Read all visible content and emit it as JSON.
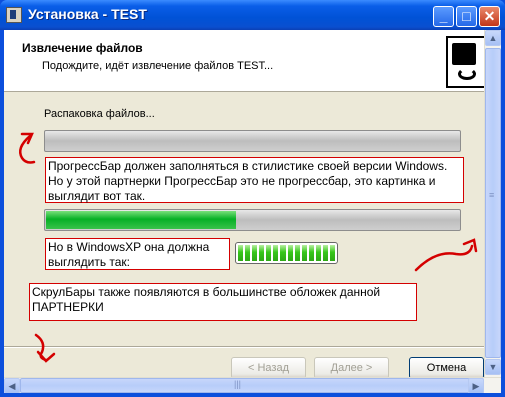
{
  "window": {
    "title": "Установка - TEST",
    "minimize_glyph": "_",
    "maximize_glyph": "□",
    "close_glyph": "✕"
  },
  "header": {
    "title": "Извлечение файлов",
    "subtitle": "Подождите, идёт извлечение файлов TEST..."
  },
  "main": {
    "status": "Распаковка файлов...",
    "progress_top": 0,
    "progress_main": 0.46,
    "progress_xp_segments": 14,
    "notes": {
      "note1": "ПрогрессБар должен заполняться в стилистике своей версии Windows. Но у этой партнерки ПрогрессБар это не прогрессбар, это картинка и выглядит вот так.",
      "note2": "Но в WindowsXP она должна выглядить так:",
      "note3": "СкрулБары также появляются в большинстве обложек данной ПАРТНЕРКИ"
    }
  },
  "buttons": {
    "back": "< Назад",
    "next": "Далее >",
    "cancel": "Отмена"
  },
  "colors": {
    "annotation": "#d40000",
    "titlebar": "#0a5ee8",
    "progress_green": "#06b025"
  }
}
